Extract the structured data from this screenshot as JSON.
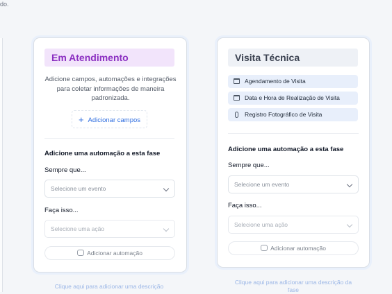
{
  "top_fragment": "do.",
  "cards": {
    "atendimento": {
      "title": "Em Atendimento",
      "description": "Adicione campos, automações e integrações para coletar informações de maneira padronizada.",
      "add_fields_label": "Adicionar campos",
      "automation_heading": "Adicione uma automação a esta fase",
      "when_label": "Sempre que...",
      "event_placeholder": "Selecione um evento",
      "do_label": "Faça isso...",
      "action_placeholder": "Selecione uma ação",
      "add_automation_label": "Adicionar automação",
      "footer_link": "Clique aqui para adicionar uma descrição"
    },
    "visita": {
      "title": "Visita Técnica",
      "fields": [
        {
          "label": "Agendamento de Visita",
          "icon": "calendar-icon"
        },
        {
          "label": "Data e Hora de Realização de Visita",
          "icon": "datetime-icon"
        },
        {
          "label": "Registro Fotográfico de Visita",
          "icon": "paperclip-icon"
        }
      ],
      "automation_heading": "Adicione uma automação a esta fase",
      "when_label": "Sempre que...",
      "event_placeholder": "Selecione um evento",
      "do_label": "Faça isso...",
      "action_placeholder": "Selecione uma ação",
      "add_automation_label": "Adicionar automação",
      "footer_link": "Clique aqui para adicionar uma descrição da fase"
    }
  },
  "colors": {
    "accent_purple": "#8b2fc1",
    "title_purple_bg": "#f2e4fb",
    "link_blue": "#2f6ee0",
    "field_bg": "#e8effb"
  }
}
